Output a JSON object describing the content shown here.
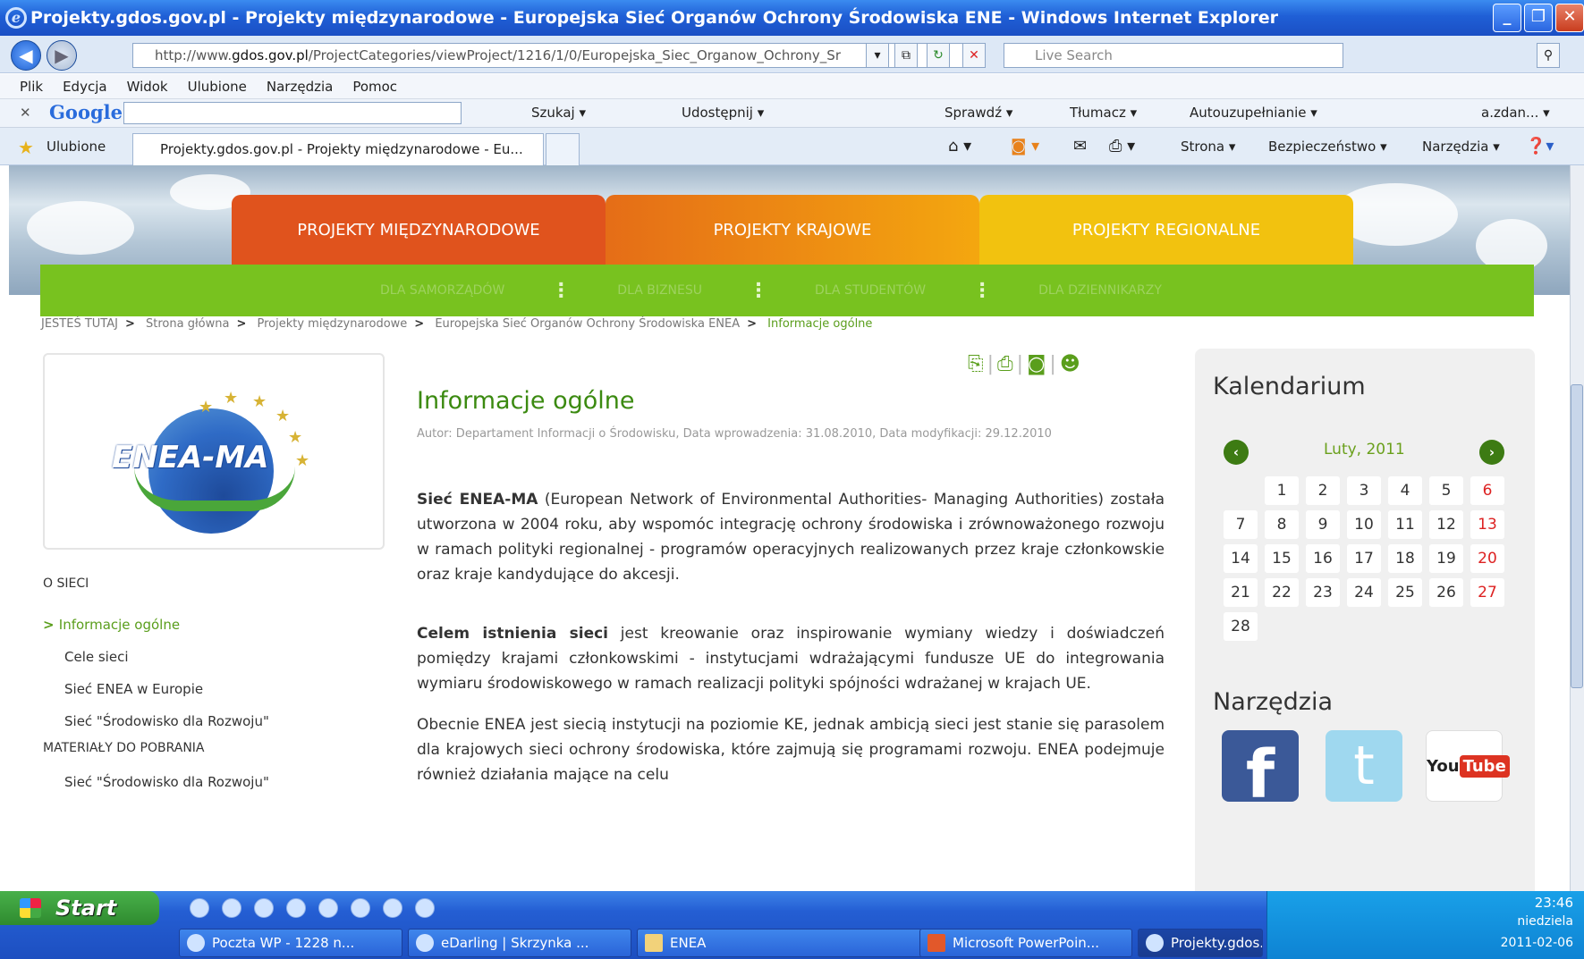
{
  "window": {
    "title": "Projekty.gdos.gov.pl - Projekty międzynarodowe - Europejska Sieć Organów Ochrony Środowiska ENE - Windows Internet Explorer"
  },
  "address": {
    "url_prefix": "http://www.",
    "url_domain": "gdos.gov.pl",
    "url_rest": "/ProjectCategories/viewProject/1216/1/0/Europejska_Siec_Organow_Ochrony_Sr",
    "search_placeholder": "Live Search"
  },
  "menu": [
    "Plik",
    "Edycja",
    "Widok",
    "Ulubione",
    "Narzędzia",
    "Pomoc"
  ],
  "googlebar": {
    "logo": "Google",
    "items": [
      "Szukaj ▾",
      "Udostępnij ▾",
      "Sprawdź ▾",
      "Tłumacz ▾",
      "Autouzupełnianie ▾",
      "a.zdan... ▾"
    ]
  },
  "favbar": {
    "favorites": "Ulubione",
    "tab": "Projekty.gdos.gov.pl - Projekty międzynarodowe - Eu...",
    "tools": [
      "Strona ▾",
      "Bezpieczeństwo ▾",
      "Narzędzia ▾"
    ]
  },
  "site": {
    "tabs": [
      {
        "label": "PROJEKTY MIĘDZYNARODOWE",
        "color": "#e0531d"
      },
      {
        "label": "PROJEKTY KRAJOWE",
        "color": "#f28c0f"
      },
      {
        "label": "PROJEKTY REGIONALNE",
        "color": "#f2c20f"
      }
    ],
    "subnav": [
      "DLA SAMORZĄDÓW",
      "DLA BIZNESU",
      "DLA STUDENTÓW",
      "DLA DZIENNIKARZY"
    ],
    "breadcrumb": [
      "JESTEŚ TUTAJ",
      "Strona główna",
      "Projekty międzynarodowe",
      "Europejska Sieć Organów Ochrony Środowiska ENEA",
      "Informacje ogólne"
    ],
    "logo_text": "ENEA-MA",
    "sidebar": {
      "head1": "O SIECI",
      "items1": [
        "Informacje ogólne",
        "Cele sieci",
        "Sieć ENEA w Europie",
        "Sieć \"Środowisko dla Rozwoju\""
      ],
      "head2": "MATERIAŁY DO POBRANIA",
      "items2": [
        "Sieć \"Środowisko dla Rozwoju\""
      ]
    },
    "article": {
      "title": "Informacje ogólne",
      "meta": "Autor: Departament Informacji o Środowisku, Data wprowadzenia: 31.08.2010, Data modyfikacji: 29.12.2010",
      "p1_bold": "Sieć ENEA-MA",
      "p1": " (European Network of Environmental Authorities- Managing Authorities) została utworzona w 2004 roku, aby wspomóc integrację ochrony środowiska i zrównoważonego rozwoju w ramach polityki regionalnej - programów operacyjnych realizowanych przez kraje członkowskie oraz kraje kandydujące do akcesji.",
      "p2_bold": "Celem istnienia sieci",
      "p2": " jest kreowanie oraz inspirowanie wymiany wiedzy i doświadczeń pomiędzy krajami członkowskimi - instytucjami wdrażającymi fundusze UE do integrowania wymiaru środowiskowego w ramach realizacji polityki spójności wdrażanej w krajach UE.",
      "p3": "Obecnie ENEA jest siecią instytucji na poziomie KE, jednak ambicją sieci jest stanie się parasolem dla krajowych sieci ochrony środowiska, które zajmują się programami rozwoju. ENEA podejmuje również działania mające na celu"
    },
    "calendar": {
      "title": "Kalendarium",
      "month": "Luty, 2011",
      "days": [
        "",
        "1",
        "2",
        "3",
        "4",
        "5",
        "6",
        "7",
        "8",
        "9",
        "10",
        "11",
        "12",
        "13",
        "14",
        "15",
        "16",
        "17",
        "18",
        "19",
        "20",
        "21",
        "22",
        "23",
        "24",
        "25",
        "26",
        "27",
        "28"
      ]
    },
    "tools_title": "Narzędzia",
    "youtube": {
      "you": "You",
      "tube": "Tube"
    }
  },
  "taskbar": {
    "start": "Start",
    "tasks": [
      "Poczta WP - 1228 n...",
      "eDarling | Skrzynka ...",
      "ENEA",
      "Microsoft PowerPoin...",
      "Projekty.gdos.gov...."
    ],
    "time": "23:46",
    "day": "niedziela",
    "date": "2011-02-06"
  }
}
